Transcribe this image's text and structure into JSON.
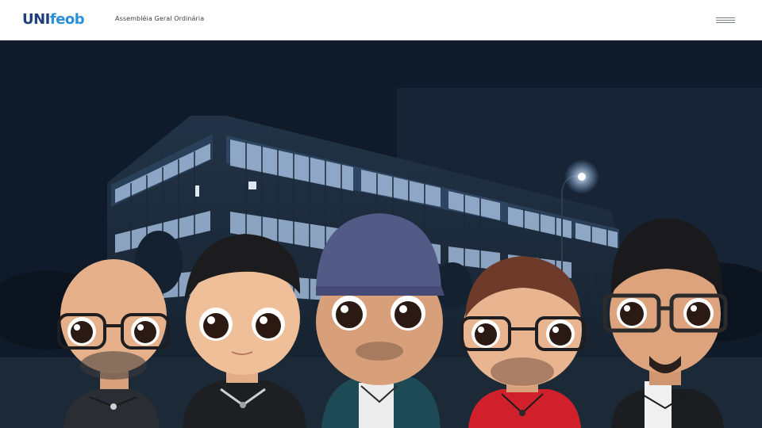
{
  "header": {
    "logo_text_pre": "UNI",
    "logo_text_post": "feob",
    "subtitle": "Assembléia Geral Ordinária"
  },
  "menu": {
    "icon": "hamburger-menu-icon"
  },
  "hero": {
    "accent_colors": [
      "#f2e600",
      "#1e8ad6"
    ],
    "background_color": "#101d2d",
    "avatars": [
      {
        "name": "avatar-bald-glasses",
        "skin": "#e9b48f",
        "hair": "none",
        "shirt": "#26292e"
      },
      {
        "name": "avatar-dark-hair",
        "skin": "#efbf99",
        "hair": "#1d1d1f",
        "shirt": "#1f2124"
      },
      {
        "name": "avatar-cap",
        "skin": "#d7a07b",
        "hair": "cap",
        "cap": "#545a86",
        "shirt": "#1f4b57"
      },
      {
        "name": "avatar-red-shirt-glasses",
        "skin": "#eab491",
        "hair": "#6b3a2b",
        "shirt": "#d4202c"
      },
      {
        "name": "avatar-curly-hair-glasses",
        "skin": "#dca37d",
        "hair": "#1a1a1c",
        "shirt": "#1a1c20"
      }
    ]
  }
}
